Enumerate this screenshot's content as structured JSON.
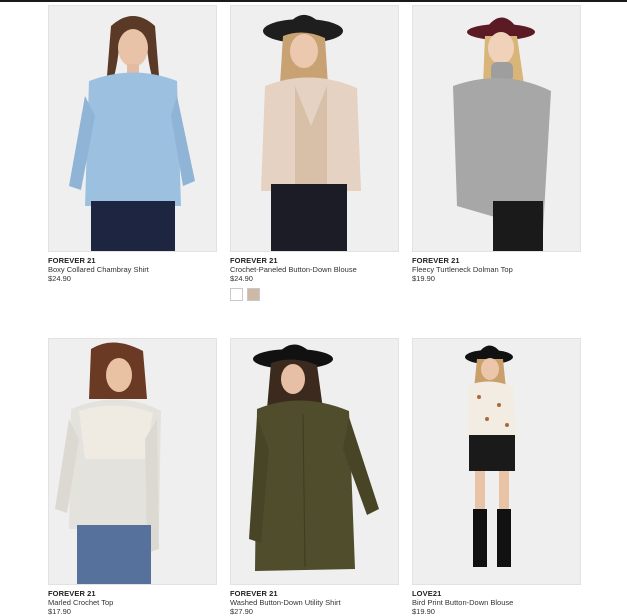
{
  "products": [
    {
      "brand": "FOREVER 21",
      "name": "Boxy Collared Chambray Shirt",
      "price": "$24.90"
    },
    {
      "brand": "FOREVER 21",
      "name": "Crochet-Paneled Button-Down Blouse",
      "price": "$24.90",
      "swatches": [
        {
          "color": "#ffffff",
          "label": "cream-swatch"
        },
        {
          "color": "#cdb9a5",
          "label": "taupe-swatch"
        }
      ]
    },
    {
      "brand": "FOREVER 21",
      "name": "Fleecy Turtleneck Dolman Top",
      "price": "$19.90"
    },
    {
      "brand": "FOREVER 21",
      "name": "Marled Crochet Top",
      "price": "$17.90"
    },
    {
      "brand": "FOREVER 21",
      "name": "Washed Button-Down Utility Shirt",
      "price": "$27.90"
    },
    {
      "brand": "LOVE21",
      "name": "Bird Print Button-Down Blouse",
      "price": "$19.90"
    }
  ],
  "colors": {
    "chambray": "#9cc0e0",
    "blush": "#e6d2c2",
    "heather-grey": "#a7a7a7",
    "oatmeal": "#e4e2dc",
    "olive": "#4f4d2c",
    "bird-print-cream": "#f3ece2"
  }
}
